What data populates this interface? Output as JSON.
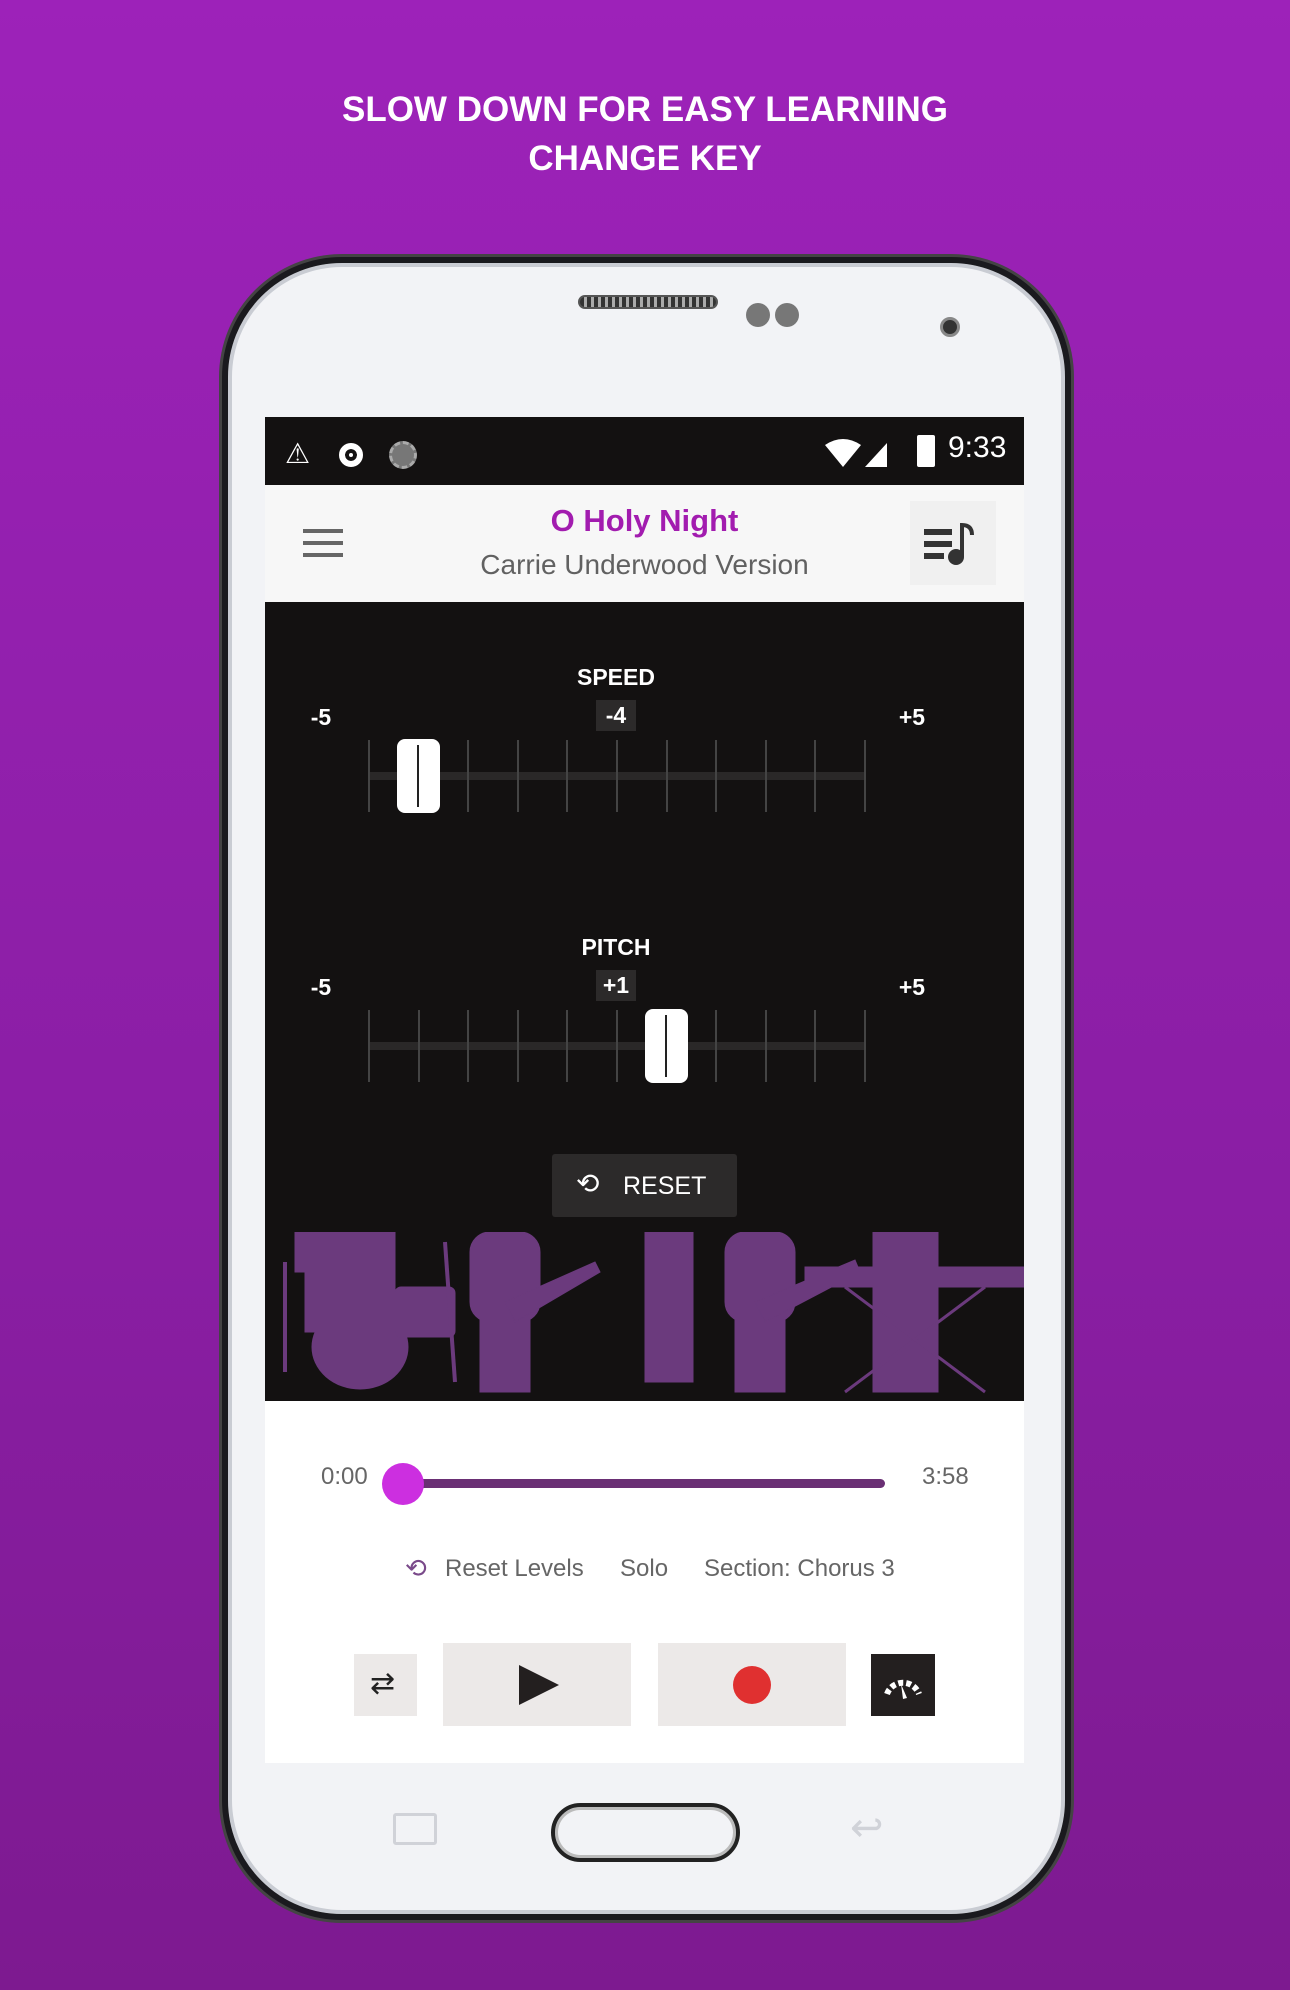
{
  "promo": {
    "line1": "SLOW DOWN FOR EASY LEARNING",
    "line2": "CHANGE KEY"
  },
  "status_bar": {
    "time": "9:33",
    "icons": [
      "warning-icon",
      "media-icon",
      "loading-icon",
      "wifi-icon",
      "signal-icon",
      "battery-charging-icon"
    ]
  },
  "header": {
    "title": "O Holy Night",
    "subtitle": "Carrie Underwood Version",
    "menu_icon": "hamburger-icon",
    "playlist_icon": "playlist-music-icon"
  },
  "speed": {
    "label": "SPEED",
    "min": "-5",
    "max": "+5",
    "value": "-4",
    "value_num": -4
  },
  "pitch": {
    "label": "PITCH",
    "min": "-5",
    "max": "+5",
    "value": "+1",
    "value_num": 1
  },
  "reset_button": {
    "label": "RESET"
  },
  "timeline": {
    "start": "0:00",
    "end": "3:58",
    "progress": 0
  },
  "links": {
    "reset_levels": "Reset Levels",
    "solo": "Solo",
    "section": "Section: Chorus 3"
  },
  "colors": {
    "accent": "#a21caf",
    "thumb": "#cc2fe0",
    "track": "#6a2f74",
    "record": "#e03030",
    "background": "#9b22b8"
  }
}
